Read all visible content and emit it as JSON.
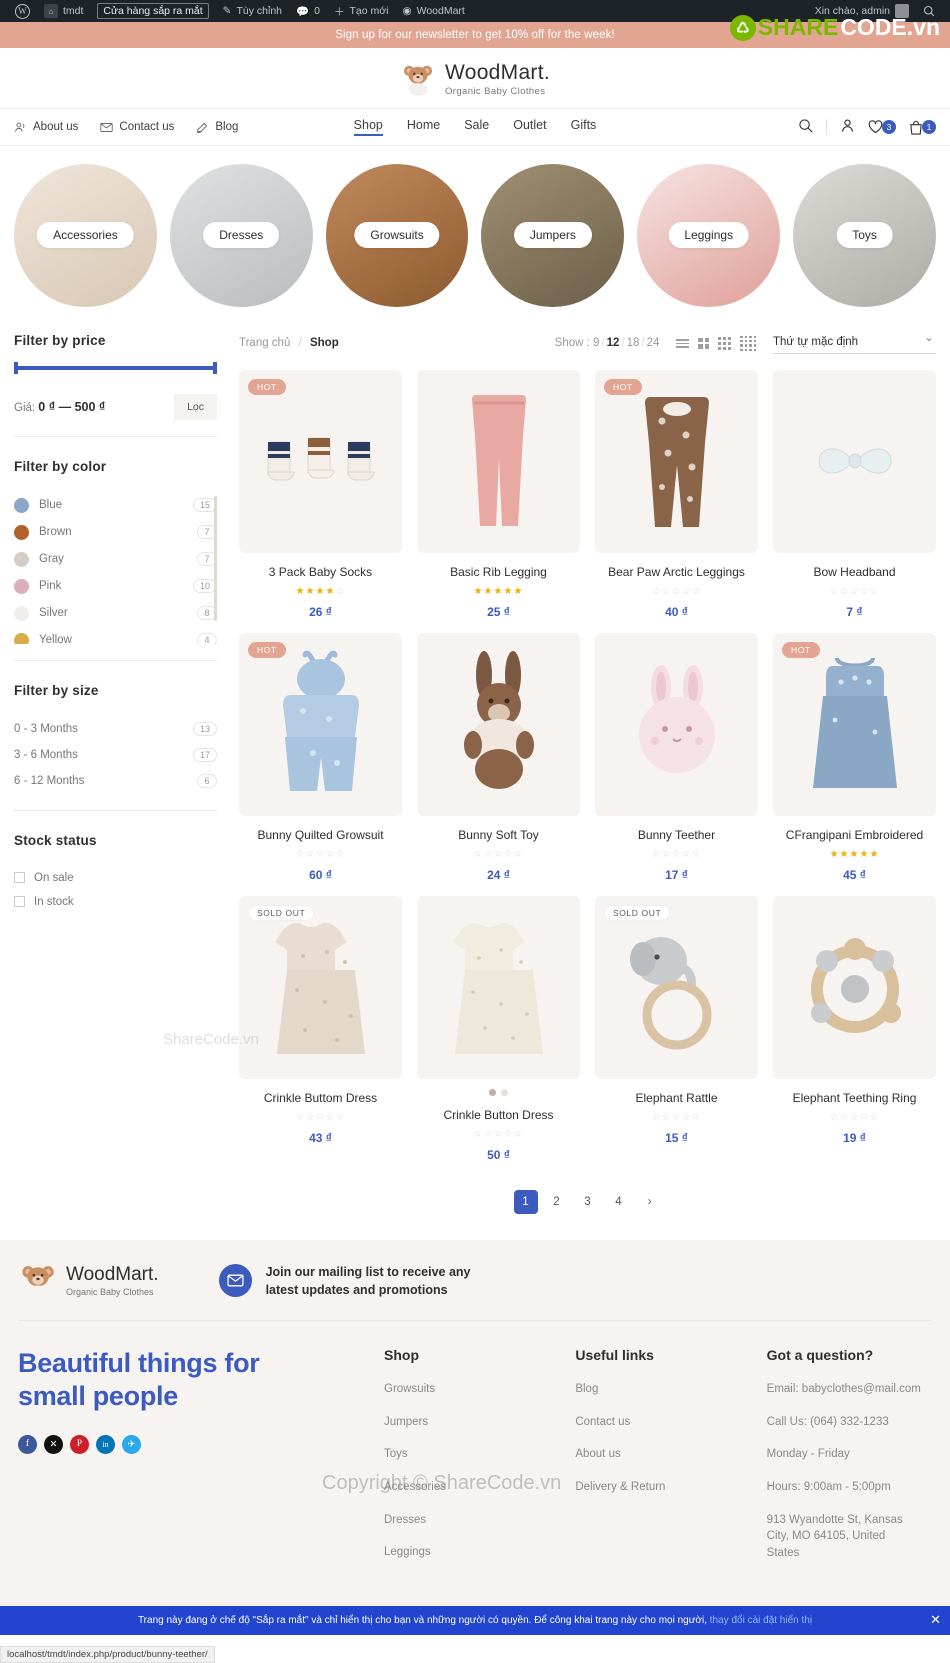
{
  "admin_bar": {
    "logo_icon": "wordpress-icon",
    "site_name": "tmdt",
    "coming_soon": "Cửa hàng sắp ra mắt",
    "customize": "Tùy chỉnh",
    "comments_count": "0",
    "new": "Tạo mới",
    "theme": "WoodMart",
    "greeting": "Xin chào, admin"
  },
  "promo": {
    "text": "Sign up for our newsletter to get 10% off for the week!"
  },
  "watermark": {
    "brand_green": "SHARE",
    "brand_white": "CODE.vn",
    "mark1": "ShareCode.vn",
    "mark2": "Copyright © ShareCode.vn"
  },
  "logo": {
    "name": "WoodMart.",
    "tagline": "Organic Baby Clothes"
  },
  "nav": {
    "left": [
      {
        "label": "About us",
        "icon": "users-icon"
      },
      {
        "label": "Contact us",
        "icon": "envelope-icon"
      },
      {
        "label": "Blog",
        "icon": "pencil-icon"
      }
    ],
    "center": [
      {
        "label": "Shop",
        "active": true
      },
      {
        "label": "Home",
        "active": false
      },
      {
        "label": "Sale",
        "active": false
      },
      {
        "label": "Outlet",
        "active": false
      },
      {
        "label": "Gifts",
        "active": false
      }
    ],
    "right": {
      "search_icon": "search-icon",
      "account_icon": "user-icon",
      "wishlist_icon": "heart-icon",
      "wishlist_count": "3",
      "cart_icon": "bag-icon",
      "cart_count": "1"
    }
  },
  "categories": [
    {
      "label": "Accessories",
      "color": "#e7dcd2"
    },
    {
      "label": "Dresses",
      "color": "#cfd2d3"
    },
    {
      "label": "Growsuits",
      "color": "#b07a4e"
    },
    {
      "label": "Jumpers",
      "color": "#8e7f66"
    },
    {
      "label": "Leggings",
      "color": "#e8b3ac"
    },
    {
      "label": "Toys",
      "color": "#c7c4c0"
    }
  ],
  "sidebar": {
    "price": {
      "title": "Filter by price",
      "label": "Giá:",
      "range": "0 ₫ — 500 ₫",
      "button": "Lọc"
    },
    "color": {
      "title": "Filter by color",
      "items": [
        {
          "name": "Blue",
          "count": "15",
          "swatch": "#8aa6c8"
        },
        {
          "name": "Brown",
          "count": "7",
          "swatch": "#b0622a"
        },
        {
          "name": "Gray",
          "count": "7",
          "swatch": "#d6cec6"
        },
        {
          "name": "Pink",
          "count": "10",
          "swatch": "#ddaebb"
        },
        {
          "name": "Silver",
          "count": "8",
          "swatch": "#f0edea"
        },
        {
          "name": "Yellow",
          "count": "4",
          "swatch": "#d9ab4a"
        }
      ]
    },
    "size": {
      "title": "Filter by size",
      "items": [
        {
          "name": "0 - 3 Months",
          "count": "13"
        },
        {
          "name": "3 - 6 Months",
          "count": "17"
        },
        {
          "name": "6 - 12 Months",
          "count": "6"
        }
      ]
    },
    "stock": {
      "title": "Stock status",
      "items": [
        {
          "name": "On sale"
        },
        {
          "name": "In stock"
        }
      ]
    }
  },
  "toolbar": {
    "breadcrumb_home": "Trang chủ",
    "breadcrumb_sep": "/",
    "breadcrumb_current": "Shop",
    "show_label": "Show :",
    "show_options": [
      "9",
      "12",
      "18",
      "24"
    ],
    "show_active": "12",
    "sort_selected": "Thứ tự mặc định"
  },
  "products": [
    {
      "name": "3 Pack Baby Socks",
      "price": "26 ₫",
      "rating": 4,
      "badge": "HOT",
      "bg": "#f7f3f0"
    },
    {
      "name": "Basic Rib Legging",
      "price": "25 ₫",
      "rating": 5,
      "badge": "",
      "bg": "#f7f3f0"
    },
    {
      "name": "Bear Paw Arctic Leggings",
      "price": "40 ₫",
      "rating": 0,
      "badge": "HOT",
      "bg": "#f7f3f0"
    },
    {
      "name": "Bow Headband",
      "price": "7 ₫",
      "rating": 0,
      "badge": "",
      "bg": "#f7f3f0"
    },
    {
      "name": "Bunny Quilted Growsuit",
      "price": "60 ₫",
      "rating": 0,
      "badge": "HOT",
      "bg": "#f7f3f0"
    },
    {
      "name": "Bunny Soft Toy",
      "price": "24 ₫",
      "rating": 0,
      "badge": "",
      "bg": "#f7f3f0"
    },
    {
      "name": "Bunny Teether",
      "price": "17 ₫",
      "rating": 0,
      "badge": "",
      "bg": "#f7f3f0"
    },
    {
      "name": "CFrangipani Embroidered",
      "price": "45 ₫",
      "rating": 5,
      "badge": "HOT",
      "bg": "#f7f3f0"
    },
    {
      "name": "Crinkle Buttom Dress",
      "price": "43 ₫",
      "rating": 0,
      "badge": "SOLD OUT",
      "bg": "#f7f3f0"
    },
    {
      "name": "Crinkle Button Dress",
      "price": "50 ₫",
      "rating": 0,
      "badge": "",
      "bg": "#f7f3f0",
      "dots": true
    },
    {
      "name": "Elephant Rattle",
      "price": "15 ₫",
      "rating": 0,
      "badge": "SOLD OUT",
      "bg": "#f7f3f0"
    },
    {
      "name": "Elephant Teething Ring",
      "price": "19 ₫",
      "rating": 0,
      "badge": "",
      "bg": "#f7f3f0"
    }
  ],
  "pagination": {
    "pages": [
      "1",
      "2",
      "3",
      "4"
    ],
    "active": "1",
    "next": "›"
  },
  "footer": {
    "logo": {
      "name": "WoodMart.",
      "tagline": "Organic Baby Clothes"
    },
    "newsletter": {
      "icon": "envelope-icon",
      "line1": "Join our mailing list to receive any",
      "line2": "latest updates and promotions"
    },
    "headline_line1": "Beautiful things for",
    "headline_line2": "small people",
    "socials": [
      {
        "name": "facebook-icon",
        "glyph": "f",
        "color": "#3b5998"
      },
      {
        "name": "x-twitter-icon",
        "glyph": "✕",
        "color": "#111111"
      },
      {
        "name": "pinterest-icon",
        "glyph": "P",
        "color": "#cb2027"
      },
      {
        "name": "linkedin-icon",
        "glyph": "in",
        "color": "#0077b5"
      },
      {
        "name": "telegram-icon",
        "glyph": "✈",
        "color": "#29a9eb"
      }
    ],
    "columns": [
      {
        "title": "Shop",
        "links": [
          "Growsuits",
          "Jumpers",
          "Toys",
          "Accessories",
          "Dresses",
          "Leggings"
        ]
      },
      {
        "title": "Useful links",
        "links": [
          "Blog",
          "Contact us",
          "About us",
          "Delivery & Return"
        ]
      },
      {
        "title": "Got a question?",
        "links": [
          "Email: babyclothes@mail.com",
          "Call Us: (064) 332-1233",
          "Monday - Friday",
          "Hours: 9:00am - 5:00pm",
          "913 Wyandotte St, Kansas City, MO 64105, United States"
        ]
      }
    ]
  },
  "notice": {
    "text": "Trang này đang ở chế độ \"Sắp ra mắt\" và chỉ hiển thị cho bạn và những người có quyền. Để công khai trang này cho mọi người,",
    "link": "thay đổi cài đặt hiển thị",
    "close": "✕"
  },
  "status_bar": {
    "url": "localhost/tmdt/index.php/product/bunny-teether/"
  }
}
